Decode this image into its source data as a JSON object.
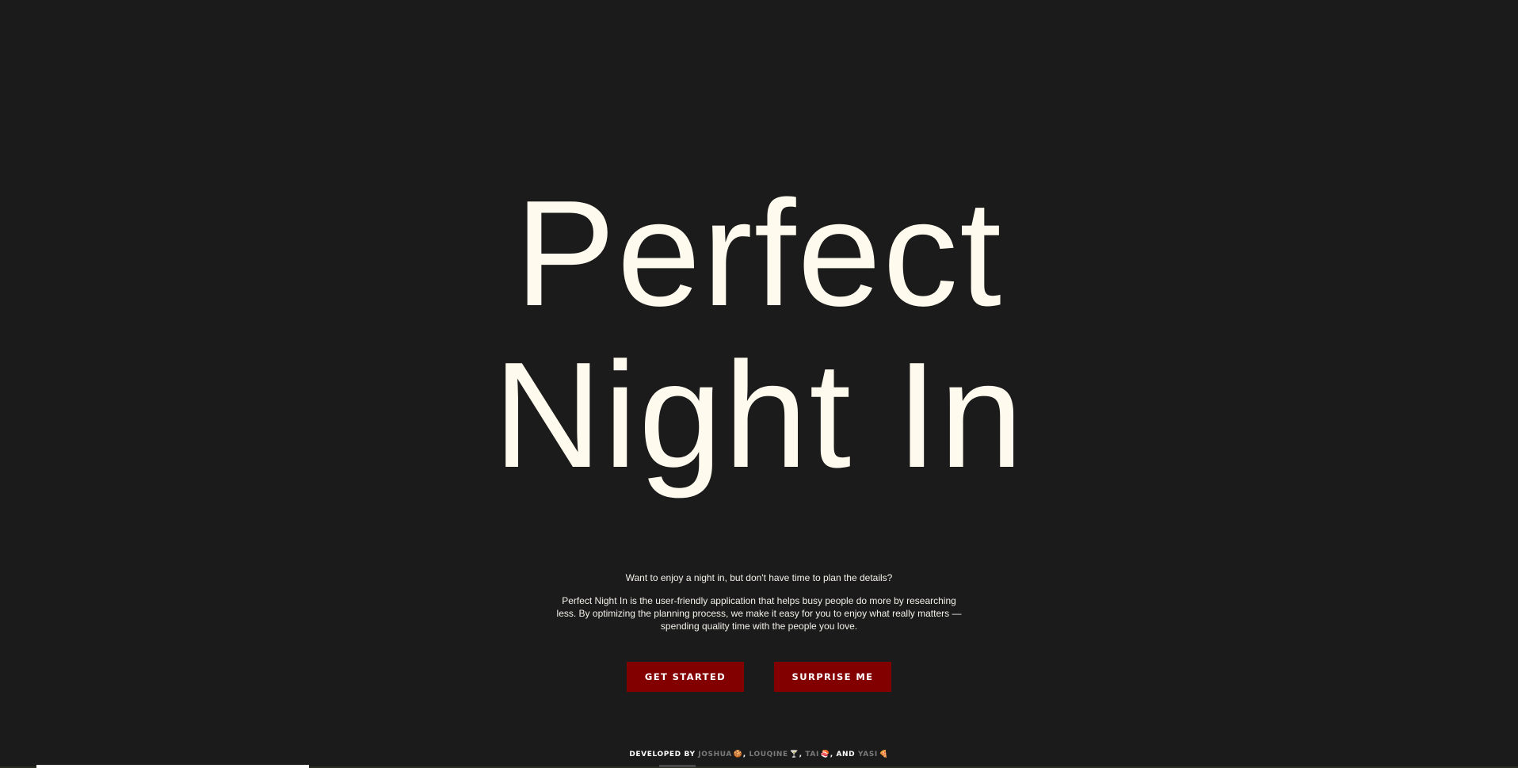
{
  "hero": {
    "line1": "Perfect",
    "line2": "Night In"
  },
  "intro": {
    "tagline": "Want to enjoy a night in, but don't have time to plan the details?",
    "description": "Perfect Night In is the user-friendly application that helps busy people do more by researching less. By optimizing the planning process, we make it easy for you to enjoy what really matters — spending quality time with the people you love."
  },
  "actions": {
    "get_started": "GET STARTED",
    "surprise_me": "SURPRISE ME"
  },
  "credits": {
    "prefix": "DEVELOPED BY",
    "developers": [
      {
        "name": "JOSHUA",
        "emoji": "🍪"
      },
      {
        "name": "LOUQINE",
        "emoji": "🍸"
      },
      {
        "name": "TAI",
        "emoji": "🍣"
      },
      {
        "name": "YASI",
        "emoji": "🍕"
      }
    ],
    "comma": ",",
    "and": ", AND"
  },
  "colors": {
    "background": "#1b1b1b",
    "text": "#fffaee",
    "button": "#830000",
    "developer_link": "#7a7a7a"
  }
}
